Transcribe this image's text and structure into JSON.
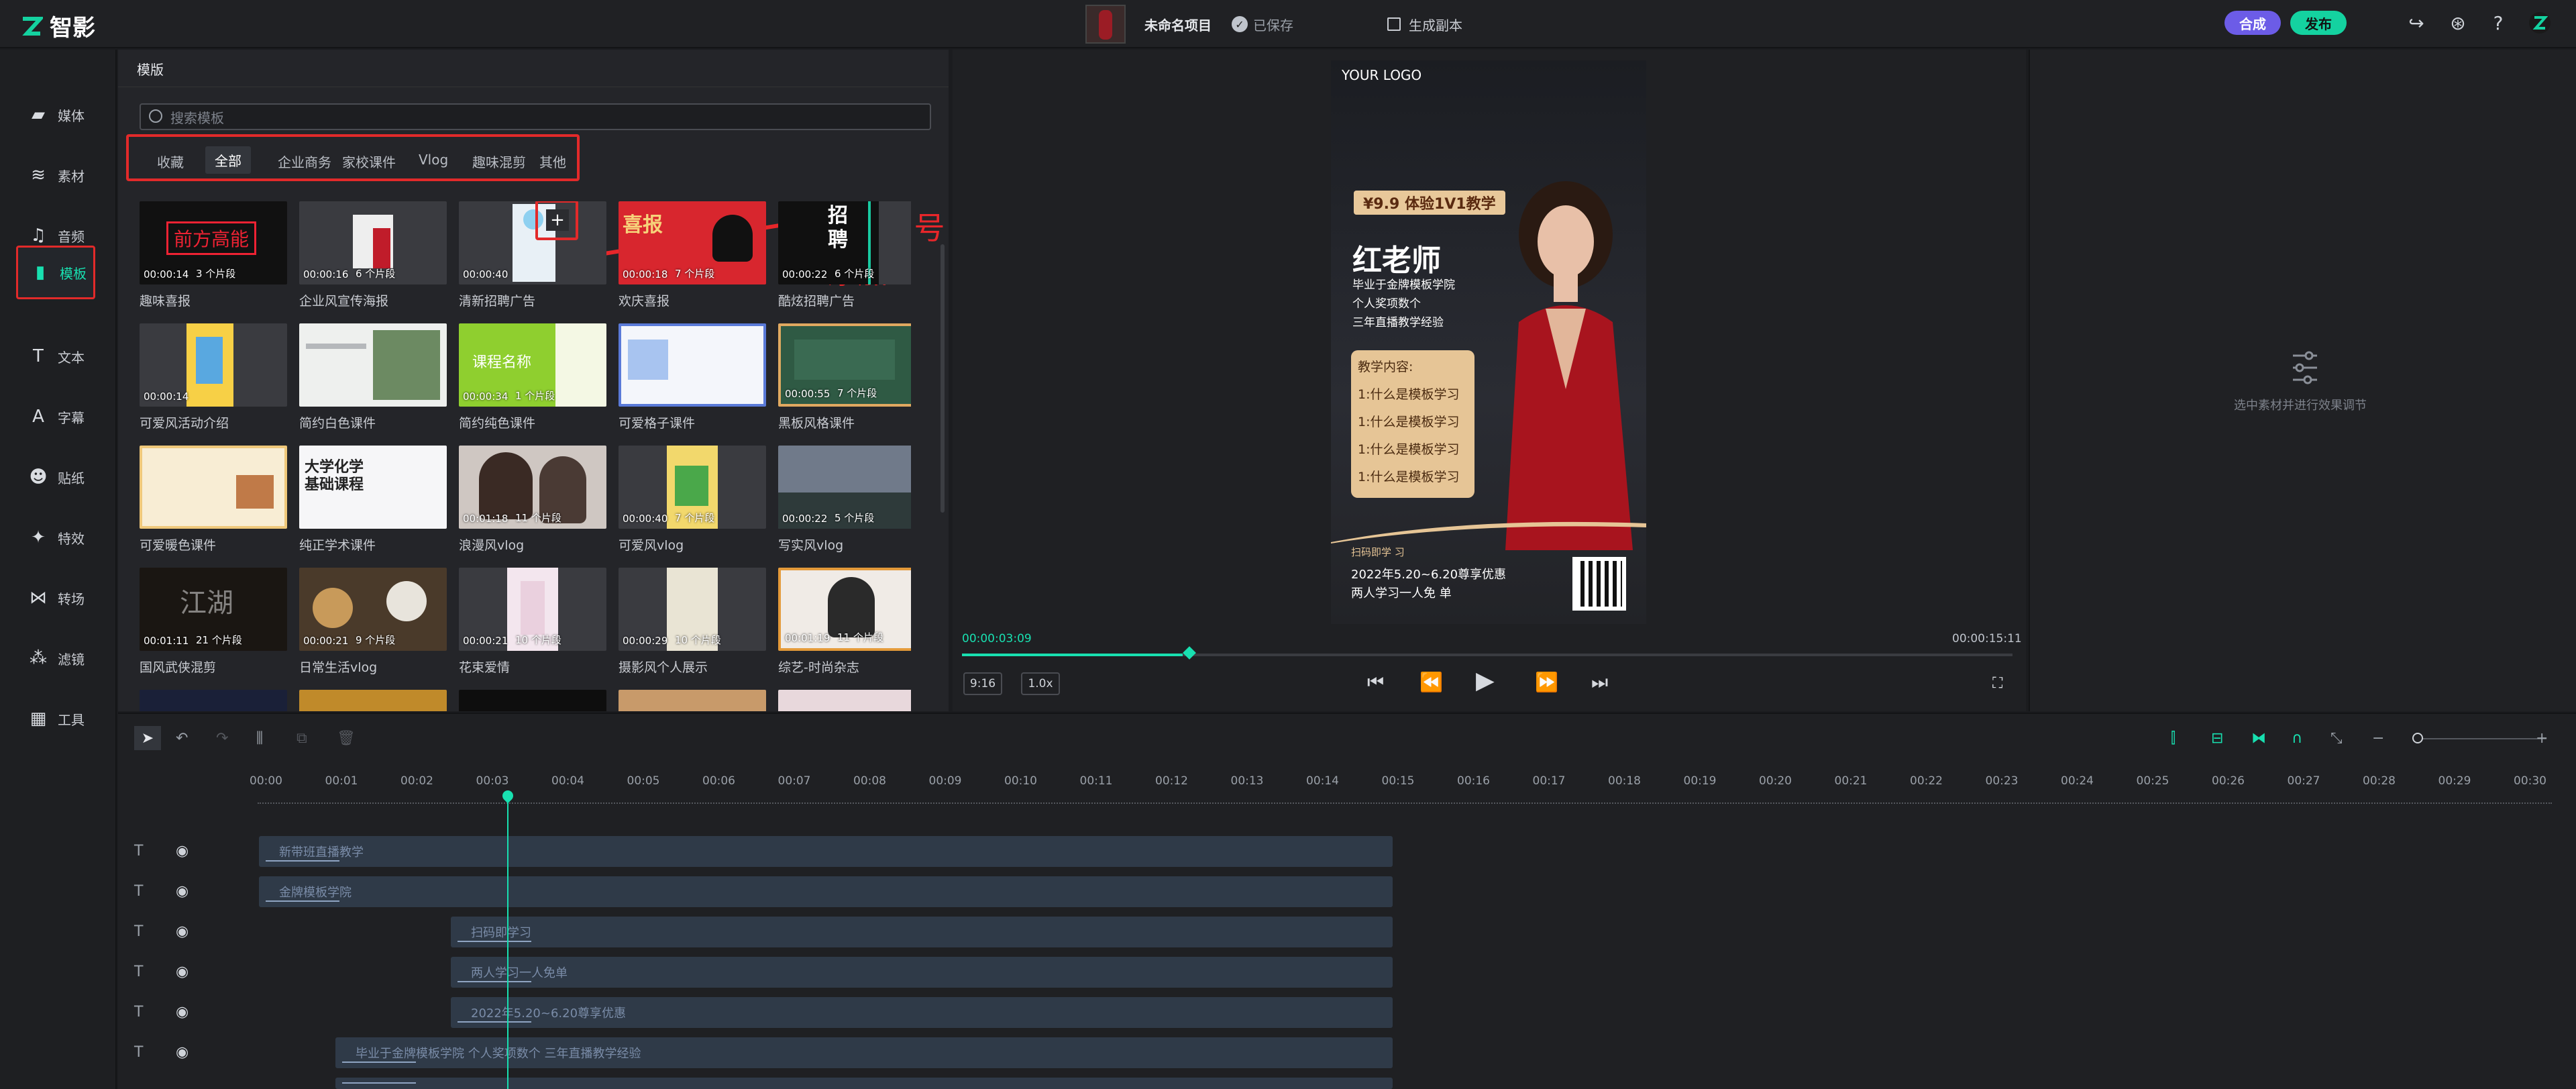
{
  "app": {
    "logo_text": "智影"
  },
  "header": {
    "project_name": "未命名项目",
    "saved": "已保存",
    "generate": "生成副本",
    "compose": "合成",
    "publish": "发布"
  },
  "sidebar": {
    "items": [
      {
        "label": "媒体",
        "icon": "folder-icon"
      },
      {
        "label": "素材",
        "icon": "layers-icon"
      },
      {
        "label": "音频",
        "icon": "music-icon"
      },
      {
        "label": "模板",
        "icon": "template-icon"
      },
      {
        "label": "文本",
        "icon": "text-icon"
      },
      {
        "label": "字幕",
        "icon": "subtitle-icon"
      },
      {
        "label": "贴纸",
        "icon": "sticker-icon"
      },
      {
        "label": "特效",
        "icon": "effect-icon"
      },
      {
        "label": "转场",
        "icon": "transition-icon"
      },
      {
        "label": "滤镜",
        "icon": "filter-icon"
      },
      {
        "label": "工具",
        "icon": "tools-icon"
      }
    ]
  },
  "panel": {
    "tab": "模版",
    "search_placeholder": "搜索模板",
    "categories": [
      "收藏",
      "全部",
      "企业商务",
      "家校课件",
      "Vlog",
      "趣味混剪",
      "其他"
    ],
    "annotation": "点击+号添加",
    "templates": [
      {
        "name": "趣味喜报",
        "time": "00:00:14",
        "clips": "3 个片段"
      },
      {
        "name": "企业风宣传海报",
        "time": "00:00:16",
        "clips": "6 个片段"
      },
      {
        "name": "清新招聘广告",
        "time": "00:00:40",
        "clips": ""
      },
      {
        "name": "欢庆喜报",
        "time": "00:00:18",
        "clips": "7 个片段"
      },
      {
        "name": "酷炫招聘广告",
        "time": "00:00:22",
        "clips": "6 个片段"
      },
      {
        "name": "可爱风活动介绍",
        "time": "00:00:14",
        "clips": ""
      },
      {
        "name": "简约白色课件",
        "time": "",
        "clips": ""
      },
      {
        "name": "简约纯色课件",
        "time": "00:00:34",
        "clips": "1 个片段"
      },
      {
        "name": "可爱格子课件",
        "time": "",
        "clips": ""
      },
      {
        "name": "黑板风格课件",
        "time": "00:00:55",
        "clips": "7 个片段"
      },
      {
        "name": "可爱暖色课件",
        "time": "",
        "clips": ""
      },
      {
        "name": "纯正学术课件",
        "time": "",
        "clips": ""
      },
      {
        "name": "浪漫风vlog",
        "time": "00:01:18",
        "clips": "11 个片段"
      },
      {
        "name": "可爱风vlog",
        "time": "00:00:40",
        "clips": "7 个片段"
      },
      {
        "name": "写实风vlog",
        "time": "00:00:22",
        "clips": "5 个片段"
      },
      {
        "name": "国风武侠混剪",
        "time": "00:01:11",
        "clips": "21 个片段"
      },
      {
        "name": "日常生活vlog",
        "time": "00:00:21",
        "clips": "9 个片段"
      },
      {
        "name": "花束爱情",
        "time": "00:00:21",
        "clips": "10 个片段"
      },
      {
        "name": "摄影风个人展示",
        "time": "00:00:29",
        "clips": "10 个片段"
      },
      {
        "name": "综艺-时尚杂志",
        "time": "00:01:19",
        "clips": "11 个片段"
      }
    ]
  },
  "preview": {
    "logo": "YOUR LOGO",
    "price": "¥9.9 体验1V1教学",
    "teacher": "红老师",
    "lines": [
      "毕业于金牌模板学院",
      "个人奖项数个",
      "三年直播教学经验"
    ],
    "course_title": "教学内容:",
    "course_items": [
      "1:什么是模板学习",
      "1:什么是模板学习",
      "1:什么是模板学习",
      "1:什么是模板学习"
    ],
    "footer": [
      "扫码即学 习",
      "2022年5.20~6.20尊享优惠",
      "两人学习一人免 单"
    ],
    "current_time": "00:00:03:09",
    "total_time": "00:00:15:11",
    "ratio": "9:16",
    "speed": "1.0x",
    "progress": 0.21
  },
  "props": {
    "hint": "选中素材并进行效果调节"
  },
  "timeline": {
    "ticks": [
      "00:00",
      "00:01",
      "00:02",
      "00:03",
      "00:04",
      "00:05",
      "00:06",
      "00:07",
      "00:08",
      "00:09",
      "00:10",
      "00:11",
      "00:12",
      "00:13",
      "00:14",
      "00:15",
      "00:16",
      "00:17",
      "00:18",
      "00:19",
      "00:20",
      "00:21",
      "00:22",
      "00:23",
      "00:24",
      "00:25",
      "00:26",
      "00:27",
      "00:28",
      "00:29",
      "00:30"
    ],
    "clips": [
      "新带班直播教学",
      "金牌模板学院",
      "扫码即学习",
      "两人学习一人免单",
      "2022年5.20~6.20尊享优惠",
      "毕业于金牌模板学院  个人奖项数个  三年直播教学经验"
    ]
  }
}
